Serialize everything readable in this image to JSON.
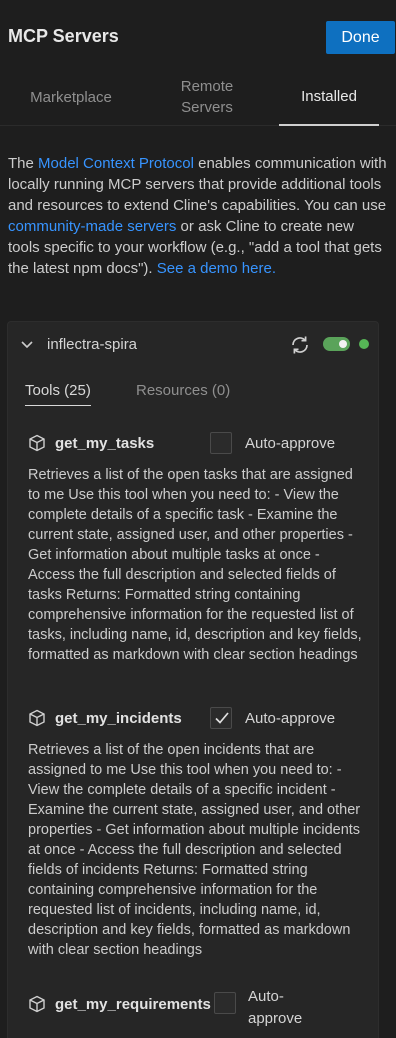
{
  "header": {
    "title": "MCP Servers",
    "done_label": "Done"
  },
  "tabs": [
    {
      "label": "Marketplace"
    },
    {
      "label": "Remote Servers"
    },
    {
      "label": "Installed"
    }
  ],
  "intro": {
    "part1": "The ",
    "link1": "Model Context Protocol",
    "part2": " enables communication with locally running MCP servers that provide additional tools and resources to extend Cline's capabilities. You can use ",
    "link2": "community-made servers",
    "part3": " or ask Cline to create new tools specific to your workflow (e.g., \"add a tool that gets the latest npm docs\"). ",
    "link3": "See a demo here."
  },
  "server": {
    "name": "inflectra-spira",
    "enabled": true,
    "status_color": "#56b556",
    "tabs": [
      {
        "label": "Tools (25)"
      },
      {
        "label": "Resources (0)"
      }
    ],
    "tools": [
      {
        "name": "get_my_tasks",
        "auto_approve_label": "Auto-approve",
        "auto_approve": false,
        "description": "Retrieves a list of the open tasks that are assigned to me Use this tool when you need to: - View the complete details of a specific task - Examine the current state, assigned user, and other properties - Get information about multiple tasks at once - Access the full description and selected fields of tasks Returns: Formatted string containing comprehensive information for the requested list of tasks, including name, id, description and key fields, formatted as markdown with clear section headings"
      },
      {
        "name": "get_my_incidents",
        "auto_approve_label": "Auto-approve",
        "auto_approve": true,
        "description": "Retrieves a list of the open incidents that are assigned to me Use this tool when you need to: - View the complete details of a specific incident - Examine the current state, assigned user, and other properties - Get information about multiple incidents at once - Access the full description and selected fields of incidents Returns: Formatted string containing comprehensive information for the requested list of incidents, including name, id, description and key fields, formatted as markdown with clear section headings"
      },
      {
        "name": "get_my_requirements",
        "auto_approve_label": "Auto-approve",
        "auto_approve": false
      }
    ]
  },
  "colors": {
    "accent": "#0e70c0",
    "link": "#3794ff",
    "toggle_on": "#5aa35a"
  }
}
